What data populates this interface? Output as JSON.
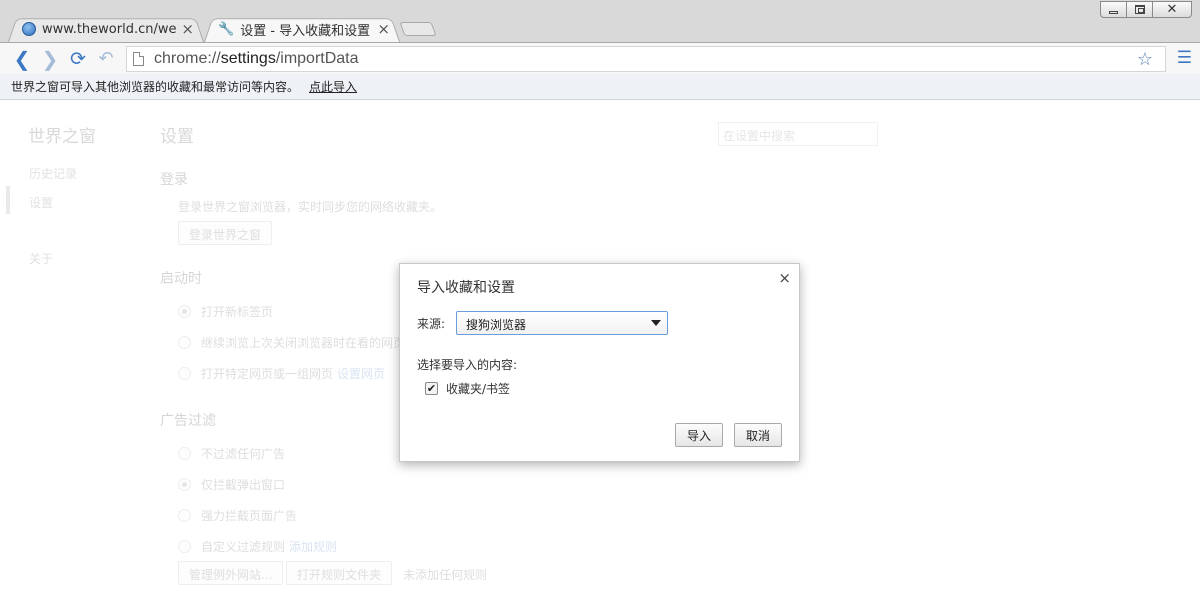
{
  "window": {
    "controls": {
      "minimize": "minimize-icon",
      "maximize": "maximize-icon",
      "close": "✕"
    }
  },
  "tabs": [
    {
      "title": "www.theworld.cn/welcor",
      "icon": "globe-icon",
      "close": "×"
    },
    {
      "title": "设置 - 导入收藏和设置",
      "icon": "wrench-icon",
      "close": "×",
      "active": true
    }
  ],
  "toolbar": {
    "url_prefix": "chrome://",
    "url_host": "settings",
    "url_path": "/importData"
  },
  "infobar": {
    "text": "世界之窗可导入其他浏览器的收藏和最常访问等内容。",
    "link": "点此导入"
  },
  "page": {
    "brand": "世界之窗",
    "sidebar": [
      "历史记录",
      "设置",
      "关于"
    ],
    "title": "设置",
    "search_placeholder": "在设置中搜索",
    "login": {
      "title": "登录",
      "desc": "登录世界之窗浏览器，实时同步您的网络收藏夹。",
      "button": "登录世界之窗"
    },
    "startup": {
      "title": "启动时",
      "options": [
        "打开新标签页",
        "继续浏览上次关闭浏览器时在看的网页",
        "打开特定网页或一组网页"
      ],
      "link": "设置网页"
    },
    "adblock": {
      "title": "广告过滤",
      "options": [
        "不过滤任何广告",
        "仅拦截弹出窗口",
        "强力拦截页面广告",
        "自定义过滤规则"
      ],
      "link": "添加规则",
      "buttons": [
        "管理例外网站...",
        "打开规则文件夹"
      ],
      "note": "未添加任何规则"
    }
  },
  "dialog": {
    "title": "导入收藏和设置",
    "close": "×",
    "source_label": "来源:",
    "source_value": "搜狗浏览器",
    "content_label": "选择要导入的内容:",
    "checkbox_label": "收藏夹/书签",
    "checkbox_checked": true,
    "import_button": "导入",
    "cancel_button": "取消"
  },
  "colors": {
    "accent": "#3d78c4",
    "select_border": "#6b9ddb"
  }
}
